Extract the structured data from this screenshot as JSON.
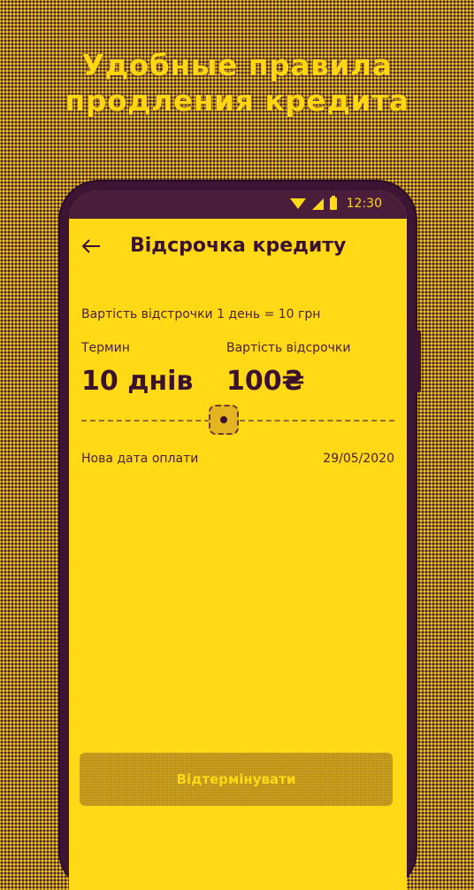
{
  "promo": {
    "headline_line1": "Удобные правила",
    "headline_line2": "продления кредита"
  },
  "status_bar": {
    "time": "12:30",
    "icons": [
      "wifi-icon",
      "signal-icon",
      "battery-icon"
    ]
  },
  "app_bar": {
    "back_icon": "arrow-left-icon",
    "title": "Відсрочка кредиту"
  },
  "deferral": {
    "rate_text": "Вартість відстрочки 1 день = 10 грн",
    "term_label": "Термин",
    "term_value": "10 днів",
    "cost_label": "Вартість відсрочки",
    "cost_value": "100₴",
    "slider_value_days": 10,
    "new_date_label": "Нова дата оплати",
    "new_date_value": "29/05/2020"
  },
  "action": {
    "button_label": "Відтермінувати"
  },
  "colors": {
    "accent_yellow": "#ffd816",
    "dark_purple": "#3d1433"
  }
}
